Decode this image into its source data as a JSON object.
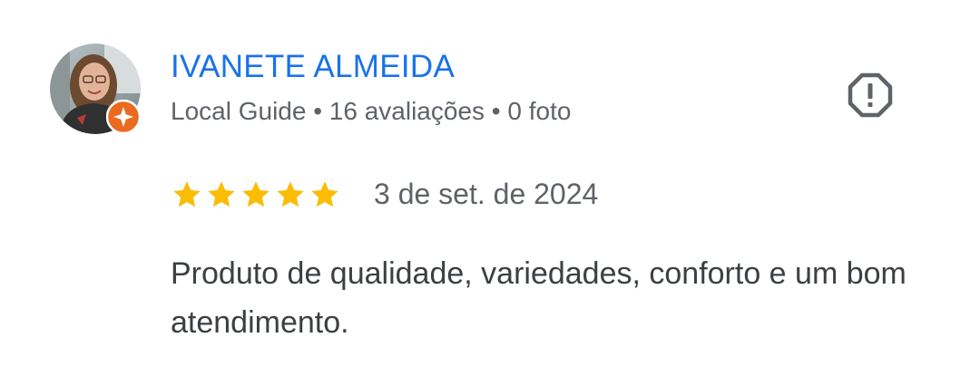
{
  "reviewer": {
    "name": "IVANETE ALMEIDA",
    "meta": "Local Guide • 16 avaliações • 0 foto",
    "badge_icon": "local-guide-star-icon"
  },
  "review": {
    "rating": 5,
    "max_rating": 5,
    "date": "3 de set. de 2024",
    "text": "Produto de qualidade, variedades, conforto e um bom atendimento."
  },
  "actions": {
    "report_icon": "report-octagon-exclamation-icon"
  },
  "colors": {
    "name": "#1a73e8",
    "meta": "#5f6368",
    "body": "#3c4043",
    "star": "#fbbc04",
    "badge": "#ea6a1f",
    "report_icon": "#5f6368"
  }
}
